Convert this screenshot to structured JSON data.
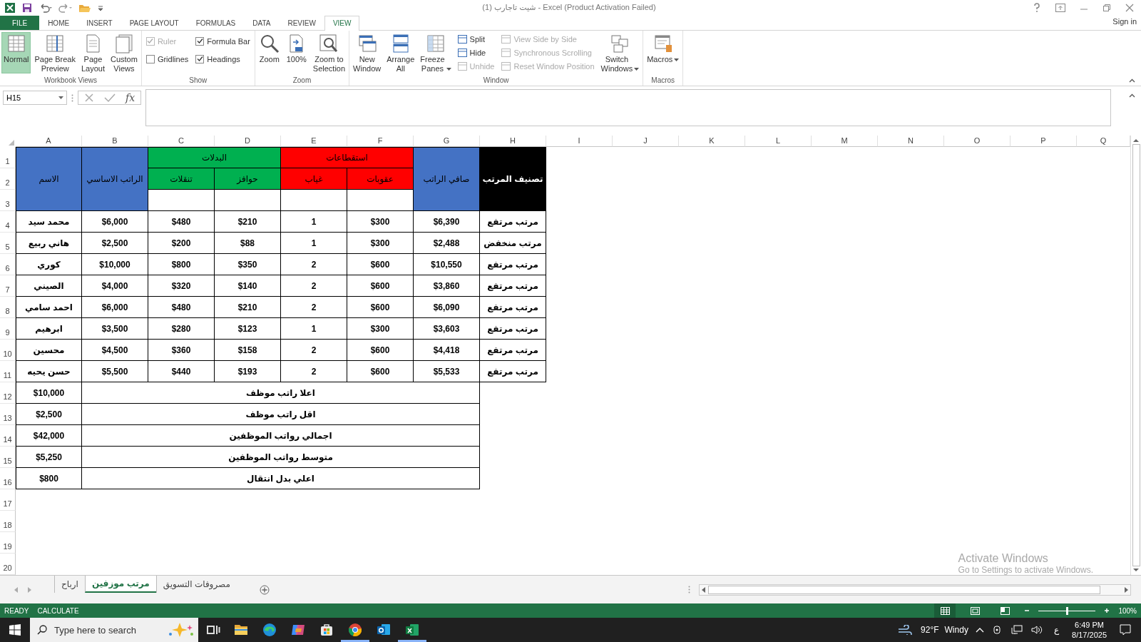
{
  "window": {
    "title": "شيت تاجارب (1) - Excel (Product Activation Failed)",
    "sign_in": "Sign in"
  },
  "ribbon_tabs": [
    {
      "label": "FILE",
      "kind": "file",
      "selected": false
    },
    {
      "label": "HOME",
      "kind": "tab",
      "selected": false
    },
    {
      "label": "INSERT",
      "kind": "tab",
      "selected": false
    },
    {
      "label": "PAGE LAYOUT",
      "kind": "tab",
      "selected": false
    },
    {
      "label": "FORMULAS",
      "kind": "tab",
      "selected": false
    },
    {
      "label": "DATA",
      "kind": "tab",
      "selected": false
    },
    {
      "label": "REVIEW",
      "kind": "tab",
      "selected": false
    },
    {
      "label": "VIEW",
      "kind": "tab",
      "selected": true
    }
  ],
  "ribbon_groups": [
    {
      "label": "Workbook Views",
      "columns": [
        {
          "kind": "big",
          "items": [
            {
              "label": "Normal",
              "selected": true
            }
          ]
        },
        {
          "kind": "big",
          "items": [
            {
              "label": "Page Break\nPreview",
              "selected": false
            }
          ]
        },
        {
          "kind": "big",
          "items": [
            {
              "label": "Page\nLayout",
              "selected": false
            }
          ]
        },
        {
          "kind": "big",
          "items": [
            {
              "label": "Custom\nViews",
              "selected": false
            }
          ]
        }
      ]
    },
    {
      "label": "Show",
      "columns": [
        {
          "kind": "stack",
          "items": [
            {
              "kind": "check",
              "label": "Ruler",
              "checked": true,
              "disabled": true
            },
            {
              "kind": "check",
              "label": "Gridlines",
              "checked": false,
              "disabled": false
            }
          ]
        },
        {
          "kind": "stack",
          "items": [
            {
              "kind": "check",
              "label": "Formula Bar",
              "checked": true,
              "disabled": false
            },
            {
              "kind": "check",
              "label": "Headings",
              "checked": true,
              "disabled": false
            }
          ]
        }
      ]
    },
    {
      "label": "Zoom",
      "columns": [
        {
          "kind": "big",
          "items": [
            {
              "label": "Zoom",
              "selected": false
            }
          ]
        },
        {
          "kind": "big",
          "items": [
            {
              "label": "100%",
              "selected": false
            }
          ]
        },
        {
          "kind": "big",
          "items": [
            {
              "label": "Zoom to\nSelection",
              "selected": false
            }
          ]
        }
      ]
    },
    {
      "label": "Window",
      "columns": [
        {
          "kind": "big",
          "items": [
            {
              "label": "New\nWindow",
              "selected": false
            }
          ]
        },
        {
          "kind": "big",
          "items": [
            {
              "label": "Arrange\nAll",
              "selected": false
            }
          ]
        },
        {
          "kind": "big",
          "items": [
            {
              "label": "Freeze\nPanes",
              "selected": false,
              "dropdown": true
            }
          ]
        },
        {
          "kind": "stack",
          "items": [
            {
              "kind": "small",
              "label": "Split",
              "disabled": false
            },
            {
              "kind": "small",
              "label": "Hide",
              "disabled": false
            },
            {
              "kind": "small",
              "label": "Unhide",
              "disabled": true
            }
          ]
        },
        {
          "kind": "stack",
          "items": [
            {
              "kind": "small",
              "label": "View Side by Side",
              "disabled": true
            },
            {
              "kind": "small",
              "label": "Synchronous Scrolling",
              "disabled": true
            },
            {
              "kind": "small",
              "label": "Reset Window Position",
              "disabled": true
            }
          ]
        },
        {
          "kind": "big",
          "items": [
            {
              "label": "Switch\nWindows",
              "selected": false,
              "dropdown": true
            }
          ]
        }
      ]
    },
    {
      "label": "Macros",
      "columns": [
        {
          "kind": "big",
          "items": [
            {
              "label": "Macros",
              "selected": false,
              "dropdown": true
            }
          ]
        }
      ]
    }
  ],
  "formula_bar": {
    "name_box": "H15",
    "function_symbol": "fx"
  },
  "columns": [
    "A",
    "B",
    "C",
    "D",
    "E",
    "F",
    "G",
    "H",
    "I",
    "J",
    "K",
    "L",
    "M",
    "N",
    "O",
    "P",
    "Q"
  ],
  "row_numbers": [
    "1",
    "2",
    "3",
    "4",
    "5",
    "6",
    "7",
    "8",
    "9",
    "10",
    "11",
    "12",
    "13",
    "14",
    "15",
    "16",
    "17",
    "18",
    "19",
    "20"
  ],
  "table_header": [
    {
      "kind": "single",
      "label": "تصنيف المرتب",
      "color": "#000000"
    },
    {
      "kind": "single",
      "label": "صافي الراتب",
      "color": "#4472c4"
    },
    {
      "kind": "group",
      "label": "استقطاعات",
      "color": "#ff0000",
      "children": [
        {
          "label": "عقوبات"
        },
        {
          "label": "غياب"
        }
      ]
    },
    {
      "kind": "group",
      "label": "البدلات",
      "color": "#00b050",
      "children": [
        {
          "label": "حوافز"
        },
        {
          "label": "تنقلات"
        }
      ]
    },
    {
      "kind": "single",
      "label": "الراتب الاساسي",
      "color": "#4472c4"
    },
    {
      "kind": "single",
      "label": "الاسم",
      "color": "#4472c4"
    }
  ],
  "employees": [
    [
      "محمد سيد",
      "$6,000",
      "$480",
      "$210",
      "1",
      "$300",
      "$6,390",
      "مرتب مرتفع"
    ],
    [
      "هاني ربيع",
      "$2,500",
      "$200",
      "$88",
      "1",
      "$300",
      "$2,488",
      "مرتب منخفض"
    ],
    [
      "كوري",
      "$10,000",
      "$800",
      "$350",
      "2",
      "$600",
      "$10,550",
      "مرتب مرتفع"
    ],
    [
      "الصيني",
      "$4,000",
      "$320",
      "$140",
      "2",
      "$600",
      "$3,860",
      "مرتب مرتفع"
    ],
    [
      "احمد سامي",
      "$6,000",
      "$480",
      "$210",
      "2",
      "$600",
      "$6,090",
      "مرتب مرتفع"
    ],
    [
      "ابرهيم",
      "$3,500",
      "$280",
      "$123",
      "1",
      "$300",
      "$3,603",
      "مرتب مرتفع"
    ],
    [
      "محسين",
      "$4,500",
      "$360",
      "$158",
      "2",
      "$600",
      "$4,418",
      "مرتب مرتفع"
    ],
    [
      "حسن يحيه",
      "$5,500",
      "$440",
      "$193",
      "2",
      "$600",
      "$5,533",
      "مرتب مرتفع"
    ]
  ],
  "summary": [
    {
      "value": "$10,000",
      "label": "اعلا راتب موظف"
    },
    {
      "value": "$2,500",
      "label": "اقل راتب موظف"
    },
    {
      "value": "$42,000",
      "label": "اجمالي رواتب الموظفين"
    },
    {
      "value": "$5,250",
      "label": "متوسط رواتب الموظفين"
    },
    {
      "value": "$800",
      "label": "اعلي بدل انتقال"
    }
  ],
  "activation": {
    "title": "Activate Windows",
    "text": "Go to Settings to activate Windows."
  },
  "sheet_tabs": [
    {
      "label": "مصروفات التسويق",
      "selected": false
    },
    {
      "label": "مرتب موزفين",
      "selected": true
    },
    {
      "label": "ارباح",
      "selected": false
    }
  ],
  "status_bar": {
    "items": [
      "READY",
      "CALCULATE"
    ],
    "views": [
      {
        "selected": true
      },
      {
        "selected": false
      },
      {
        "selected": false
      }
    ],
    "zoom": {
      "level": 0.5,
      "reading": "100%"
    }
  },
  "taskbar": {
    "search": {
      "placeholder": "Type here to search"
    },
    "apps": [
      {
        "running": false
      },
      {
        "running": false
      },
      {
        "running": false
      },
      {
        "running": false
      },
      {
        "running": false
      },
      {
        "running": true
      },
      {
        "running": false
      },
      {
        "running": true
      }
    ],
    "weather": {
      "temperature": "92°F",
      "condition": "Windy"
    },
    "input_language": "ع",
    "time": "6:49 PM",
    "date": "8/17/2025"
  }
}
